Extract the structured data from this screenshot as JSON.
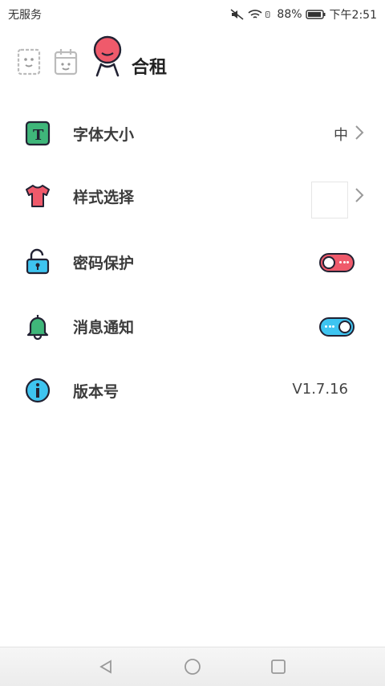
{
  "status_bar": {
    "carrier": "无服务",
    "battery": "88%",
    "time": "下午2:51"
  },
  "header": {
    "title": "合租",
    "icons": [
      "notebook-face-icon",
      "calendar-face-icon",
      "mascot-avatar-icon"
    ]
  },
  "settings": [
    {
      "label": "字体大小",
      "value": "中",
      "icon": "font-size-icon",
      "control": "chevron"
    },
    {
      "label": "样式选择",
      "icon": "shirt-icon",
      "control": "swatch-chevron"
    },
    {
      "label": "密码保护",
      "icon": "unlock-icon",
      "control": "toggle-off",
      "color": "#ef5a6b"
    },
    {
      "label": "消息通知",
      "icon": "bell-icon",
      "control": "toggle-on",
      "color": "#3ec4f0"
    },
    {
      "label": "版本号",
      "value": "V1.7.16",
      "icon": "info-icon",
      "control": "text"
    }
  ],
  "navigation": [
    "back-icon",
    "home-icon",
    "recents-icon"
  ],
  "colors": {
    "accent_red": "#ef5a6b",
    "accent_blue": "#3ec4f0",
    "accent_green": "#3fb67a"
  }
}
